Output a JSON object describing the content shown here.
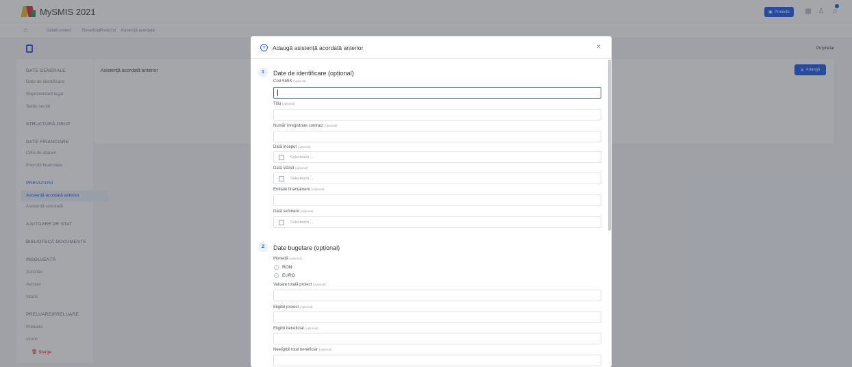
{
  "app": {
    "title": "MySMIS 2021"
  },
  "topbar": {
    "projects_label": "Proiecte"
  },
  "breadcrumb": [
    "Detalii proiect",
    "Beneficiar",
    "Proiectul",
    "Asistență acordată"
  ],
  "page": {
    "owner_label": "Proprietar"
  },
  "sidebar": {
    "items": [
      {
        "type": "head",
        "label": "DATE GENERALE"
      },
      {
        "type": "item",
        "label": "Date de identificare"
      },
      {
        "type": "item",
        "label": "Reprezentant legal"
      },
      {
        "type": "item",
        "label": "Sediu social"
      },
      {
        "type": "head",
        "label": "STRUCTURĂ GRUP"
      },
      {
        "type": "head",
        "label": "DATE FINANCIARE"
      },
      {
        "type": "item",
        "label": "Cifra de afaceri"
      },
      {
        "type": "item",
        "label": "Exerciții financiare"
      },
      {
        "type": "head",
        "label": "PREVIZIUNI"
      },
      {
        "type": "item",
        "label": "Asistență acordată anterior",
        "active": true
      },
      {
        "type": "item",
        "label": "Asistență solicitată"
      },
      {
        "type": "head",
        "label": "AJUTOARE DE STAT"
      },
      {
        "type": "head",
        "label": "BIBLIOTECĂ DOCUMENTE"
      },
      {
        "type": "head",
        "label": "INSOLVENȚĂ"
      },
      {
        "type": "item",
        "label": "Solicitări"
      },
      {
        "type": "item",
        "label": "Avizare"
      },
      {
        "type": "item",
        "label": "Istoric"
      },
      {
        "type": "head",
        "label": "PRELUARE/PRELUARE"
      },
      {
        "type": "item",
        "label": "Preluare"
      },
      {
        "type": "item",
        "label": "Istoric"
      }
    ],
    "delete_label": "Șterge"
  },
  "main": {
    "card_title": "Asistență acordată anterior",
    "add_label": "Adaugă"
  },
  "modal": {
    "title": "Adaugă asistență acordată anterior",
    "close": "×",
    "optional": "(opțional)",
    "sections": [
      {
        "num": "1",
        "title": "Date de identificare (opțional)"
      },
      {
        "num": "2",
        "title": "Date bugetare (opțional)"
      }
    ],
    "fields": {
      "cod_smis": "Cod SMIS",
      "titlu": "Titlu",
      "numar_contract": "Număr înregistrare contract",
      "data_inceput": "Dată început",
      "data_sfarsit": "Dată sfârșit",
      "entitate": "Entitate finanțatoare",
      "data_semnare": "Dată semnare",
      "moneda": "Monedă",
      "valoare_totala": "Valoare totală proiect",
      "eligibil_proiect": "Eligibil proiect",
      "eligibil_beneficiar": "Eligibil beneficiar",
      "neeligibil": "Neeligibil total beneficiar"
    },
    "date_placeholder": "Selectează ...",
    "currencies": [
      "RON",
      "EURO"
    ]
  }
}
